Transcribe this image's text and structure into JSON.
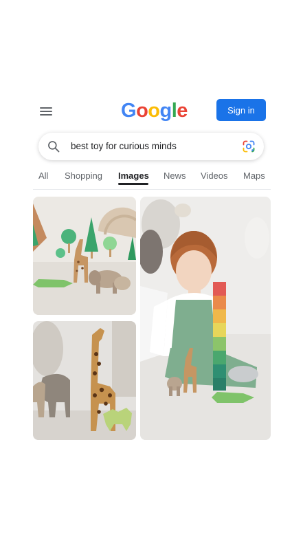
{
  "header": {
    "menu_icon": "hamburger-menu-icon",
    "logo_letters": [
      {
        "char": "G",
        "color": "#4285F4"
      },
      {
        "char": "o",
        "color": "#EA4335"
      },
      {
        "char": "o",
        "color": "#FBBC05"
      },
      {
        "char": "g",
        "color": "#4285F4"
      },
      {
        "char": "l",
        "color": "#34A853"
      },
      {
        "char": "e",
        "color": "#EA4335"
      }
    ],
    "signin_label": "Sign in"
  },
  "search": {
    "query": "best toy for curious minds",
    "search_icon": "search-icon",
    "lens_icon": "google-lens-icon"
  },
  "tabs": [
    {
      "label": "All",
      "active": false
    },
    {
      "label": "Shopping",
      "active": false
    },
    {
      "label": "Images",
      "active": true
    },
    {
      "label": "News",
      "active": false
    },
    {
      "label": "Videos",
      "active": false
    },
    {
      "label": "Maps",
      "active": false
    }
  ],
  "results": [
    {
      "subject": "wooden toy animals and trees"
    },
    {
      "subject": "child with stacking tower"
    },
    {
      "subject": "wooden giraffe and elephant"
    }
  ],
  "colors": {
    "accent": "#1a73e8",
    "text": "#202124",
    "muted": "#5f6368"
  }
}
